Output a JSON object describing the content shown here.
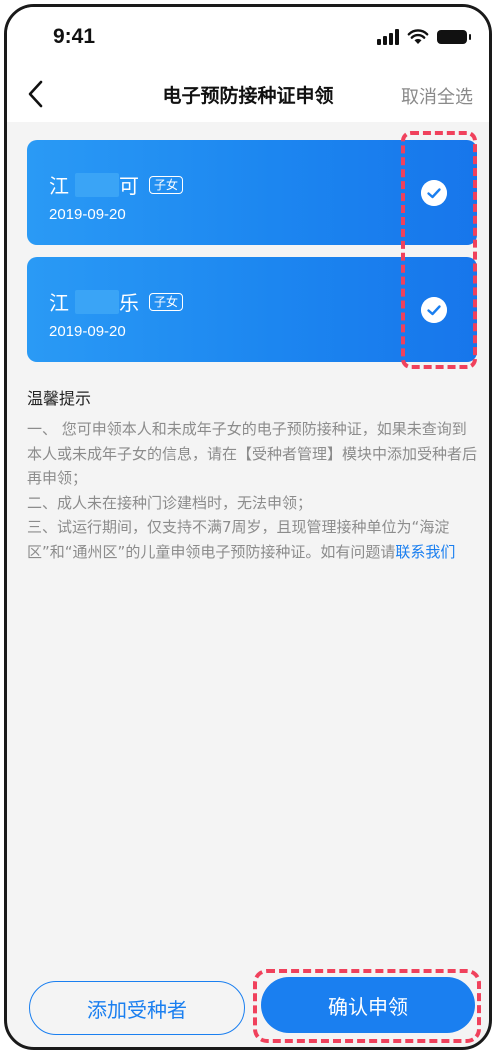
{
  "status_bar": {
    "time": "9:41"
  },
  "nav": {
    "title": "电子预防接种证申领",
    "action": "取消全选"
  },
  "cards": [
    {
      "name_start": "江",
      "name_end": "可",
      "tag": "子女",
      "date": "2019-09-20",
      "checked": true
    },
    {
      "name_start": "江",
      "name_end": "乐",
      "tag": "子女",
      "date": "2019-09-20",
      "checked": true
    }
  ],
  "tips": {
    "title": "温馨提示",
    "line1": "一、 您可申领本人和未成年子女的电子预防接种证，如果未查询到本人或未成年子女的信息，请在【受种者管理】模块中添加受种者后再申领；",
    "line2": "二、成人未在接种门诊建档时，无法申领；",
    "line3": "三、试运行期间，仅支持不满7周岁，且现管理接种单位为“海淀区”和“通州区”的儿童申领电子预防接种证。如有问题请",
    "link": "联系我们"
  },
  "buttons": {
    "add": "添加受种者",
    "confirm": "确认申领"
  },
  "colors": {
    "primary": "#1a7ff0",
    "highlight": "#f0415c",
    "background": "#f4f4f4"
  }
}
